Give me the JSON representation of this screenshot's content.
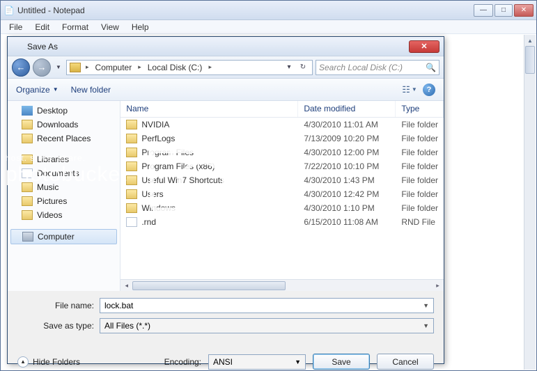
{
  "notepad": {
    "title": "Untitled - Notepad",
    "menu": [
      "File",
      "Edit",
      "Format",
      "View",
      "Help"
    ]
  },
  "dialog": {
    "title": "Save As",
    "breadcrumb": {
      "root": "Computer",
      "drive": "Local Disk (C:)"
    },
    "search_placeholder": "Search Local Disk (C:)",
    "toolbar": {
      "organize": "Organize",
      "newfolder": "New folder"
    },
    "columns": {
      "name": "Name",
      "date": "Date modified",
      "type": "Type"
    },
    "tree": [
      {
        "label": "Desktop",
        "icon": "desktop"
      },
      {
        "label": "Downloads",
        "icon": "folder"
      },
      {
        "label": "Recent Places",
        "icon": "folder"
      },
      {
        "label": "Libraries",
        "icon": "folder"
      },
      {
        "label": "Documents",
        "icon": "doc"
      },
      {
        "label": "Music",
        "icon": "folder"
      },
      {
        "label": "Pictures",
        "icon": "folder"
      },
      {
        "label": "Videos",
        "icon": "folder"
      },
      {
        "label": "Computer",
        "icon": "comp",
        "sel": true
      }
    ],
    "files": [
      {
        "name": "NVIDIA",
        "date": "4/30/2010 11:01 AM",
        "type": "File folder",
        "icon": "folder"
      },
      {
        "name": "PerfLogs",
        "date": "7/13/2009 10:20 PM",
        "type": "File folder",
        "icon": "folder"
      },
      {
        "name": "Program Files",
        "date": "4/30/2010 12:00 PM",
        "type": "File folder",
        "icon": "folder"
      },
      {
        "name": "Program Files (x86)",
        "date": "7/22/2010 10:10 PM",
        "type": "File folder",
        "icon": "folder"
      },
      {
        "name": "Useful Win7 Shortcuts",
        "date": "4/30/2010 1:43 PM",
        "type": "File folder",
        "icon": "folder"
      },
      {
        "name": "Users",
        "date": "4/30/2010 12:42 PM",
        "type": "File folder",
        "icon": "folder"
      },
      {
        "name": "Windows",
        "date": "4/30/2010 1:10 PM",
        "type": "File folder",
        "icon": "folder"
      },
      {
        "name": ".rnd",
        "date": "6/15/2010 11:08 AM",
        "type": "RND File",
        "icon": "file"
      }
    ],
    "filename_label": "File name:",
    "filename_value": "lock.bat",
    "saveas_label": "Save as type:",
    "saveas_value": "All Files  (*.*)",
    "hide_folders": "Hide Folders",
    "encoding_label": "Encoding:",
    "encoding_value": "ANSI",
    "save_btn": "Save",
    "cancel_btn": "Cancel"
  },
  "watermark": {
    "l1": "host. store. share.",
    "l2": "photobucket"
  }
}
